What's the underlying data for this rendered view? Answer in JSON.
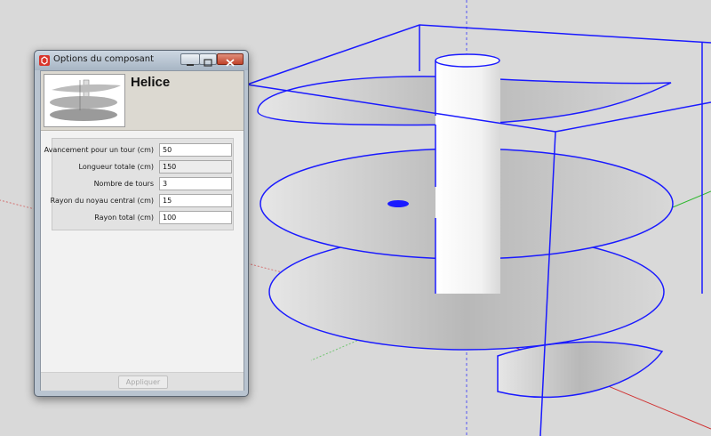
{
  "window": {
    "title": "Options du composant",
    "controls": {
      "minimize_icon": "minimize-icon",
      "maximize_icon": "maximize-icon",
      "close_icon": "close-icon"
    }
  },
  "component": {
    "name": "Helice",
    "thumbnail_icon": "helix-thumbnail-icon"
  },
  "fields": [
    {
      "label": "Avancement pour un tour (cm)",
      "value": "50",
      "editable": true
    },
    {
      "label": "Longueur totale (cm)",
      "value": "150",
      "editable": false
    },
    {
      "label": "Nombre de tours",
      "value": "3",
      "editable": true
    },
    {
      "label": "Rayon du noyau central (cm)",
      "value": "15",
      "editable": true
    },
    {
      "label": "Rayon total (cm)",
      "value": "100",
      "editable": true
    }
  ],
  "apply_label": "Appliquer",
  "apply_enabled": false,
  "colors": {
    "bounding_box": "#1a1aff",
    "axis_red": "#d03030",
    "axis_green": "#2eb82e",
    "surface": "#cfcfcf",
    "background": "#d9d9d9"
  }
}
